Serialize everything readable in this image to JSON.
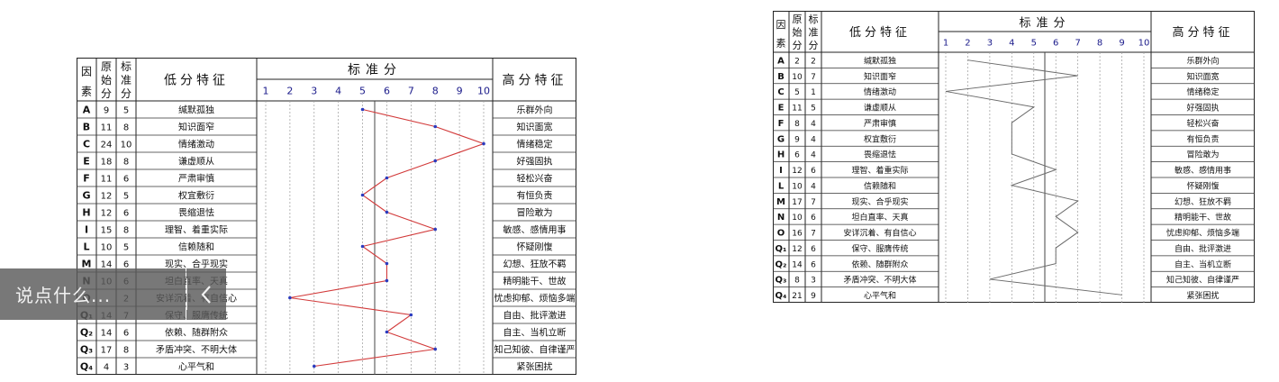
{
  "comment_bar": {
    "placeholder": "说点什么..."
  },
  "nav": {
    "prev_symbol": "<"
  },
  "table_headers": {
    "factor": "因素",
    "raw": "原始分",
    "std": "标准分",
    "low": "低分特征",
    "scale": "标准分",
    "high": "高分特征"
  },
  "scale_numbers": [
    "1",
    "2",
    "3",
    "4",
    "5",
    "6",
    "7",
    "8",
    "9",
    "10"
  ],
  "colors": {
    "left_line": "#d23a3a",
    "left_marker": "#2b3bbf",
    "right_line": "#6b6b6b",
    "grid": "#9a9a9a"
  },
  "left_profile": [
    {
      "factor": "A",
      "raw": "9",
      "std": "5",
      "low": "缄默孤独",
      "high": "乐群外向",
      "score": 5
    },
    {
      "factor": "B",
      "raw": "11",
      "std": "8",
      "low": "知识面窄",
      "high": "知识面宽",
      "score": 8
    },
    {
      "factor": "C",
      "raw": "24",
      "std": "10",
      "low": "情绪激动",
      "high": "情绪稳定",
      "score": 10
    },
    {
      "factor": "E",
      "raw": "18",
      "std": "8",
      "low": "谦虚顺从",
      "high": "好强固执",
      "score": 8
    },
    {
      "factor": "F",
      "raw": "11",
      "std": "6",
      "low": "严肃审慎",
      "high": "轻松兴奋",
      "score": 6
    },
    {
      "factor": "G",
      "raw": "12",
      "std": "5",
      "low": "权宜敷衍",
      "high": "有恒负责",
      "score": 5
    },
    {
      "factor": "H",
      "raw": "12",
      "std": "6",
      "low": "畏缩退怯",
      "high": "冒险敢为",
      "score": 6
    },
    {
      "factor": "I",
      "raw": "15",
      "std": "8",
      "low": "理智、着重实际",
      "high": "敏感、感情用事",
      "score": 8
    },
    {
      "factor": "L",
      "raw": "10",
      "std": "5",
      "low": "信赖随和",
      "high": "怀疑刚愎",
      "score": 5
    },
    {
      "factor": "M",
      "raw": "14",
      "std": "6",
      "low": "现实、合乎现实",
      "high": "幻想、狂放不羁",
      "score": 6
    },
    {
      "factor": "N",
      "raw": "10",
      "std": "6",
      "low": "坦白直率、天真",
      "high": "精明能干、世故",
      "score": 6
    },
    {
      "factor": "O",
      "raw": "",
      "std": "2",
      "low": "安详沉着、有自信心",
      "high": "忧虑抑郁、烦恼多端",
      "score": 2
    },
    {
      "factor": "Q₁",
      "raw": "14",
      "std": "7",
      "low": "保守、服膺传统",
      "high": "自由、批评激进",
      "score": 7
    },
    {
      "factor": "Q₂",
      "raw": "14",
      "std": "6",
      "low": "依赖、随群附众",
      "high": "自主、当机立断",
      "score": 6
    },
    {
      "factor": "Q₃",
      "raw": "17",
      "std": "8",
      "low": "矛盾冲突、不明大体",
      "high": "知己知彼、自律谨严",
      "score": 8
    },
    {
      "factor": "Q₄",
      "raw": "4",
      "std": "3",
      "low": "心平气和",
      "high": "紧张困扰",
      "score": 3
    }
  ],
  "right_profile": [
    {
      "factor": "A",
      "raw": "2",
      "std": "2",
      "low": "缄默孤独",
      "high": "乐群外向",
      "score": 2
    },
    {
      "factor": "B",
      "raw": "10",
      "std": "7",
      "low": "知识面窄",
      "high": "知识面宽",
      "score": 7
    },
    {
      "factor": "C",
      "raw": "5",
      "std": "1",
      "low": "情绪激动",
      "high": "情绪稳定",
      "score": 1
    },
    {
      "factor": "E",
      "raw": "11",
      "std": "5",
      "low": "谦虚顺从",
      "high": "好强固执",
      "score": 5
    },
    {
      "factor": "F",
      "raw": "8",
      "std": "4",
      "low": "严肃审慎",
      "high": "轻松兴奋",
      "score": 4
    },
    {
      "factor": "G",
      "raw": "9",
      "std": "4",
      "low": "权宜敷衍",
      "high": "有恒负责",
      "score": 4
    },
    {
      "factor": "H",
      "raw": "6",
      "std": "4",
      "low": "畏缩退怯",
      "high": "冒险敢为",
      "score": 4
    },
    {
      "factor": "I",
      "raw": "12",
      "std": "6",
      "low": "理智、着重实际",
      "high": "敏感、感情用事",
      "score": 6
    },
    {
      "factor": "L",
      "raw": "10",
      "std": "4",
      "low": "信赖随和",
      "high": "怀疑刚愎",
      "score": 4
    },
    {
      "factor": "M",
      "raw": "17",
      "std": "7",
      "low": "现实、合乎现实",
      "high": "幻想、狂放不羁",
      "score": 7
    },
    {
      "factor": "N",
      "raw": "10",
      "std": "6",
      "low": "坦白直率、天真",
      "high": "精明能干、世故",
      "score": 6
    },
    {
      "factor": "O",
      "raw": "16",
      "std": "7",
      "low": "安详沉着、有自信心",
      "high": "忧虑抑郁、烦恼多端",
      "score": 7
    },
    {
      "factor": "Q₁",
      "raw": "12",
      "std": "6",
      "low": "保守、服膺传统",
      "high": "自由、批评激进",
      "score": 6
    },
    {
      "factor": "Q₂",
      "raw": "14",
      "std": "6",
      "low": "依赖、随群附众",
      "high": "自主、当机立断",
      "score": 6
    },
    {
      "factor": "Q₃",
      "raw": "8",
      "std": "3",
      "low": "矛盾冲突、不明大体",
      "high": "知己知彼、自律谨严",
      "score": 3
    },
    {
      "factor": "Q₄",
      "raw": "21",
      "std": "9",
      "low": "心平气和",
      "high": "紧张困扰",
      "score": 9
    }
  ]
}
